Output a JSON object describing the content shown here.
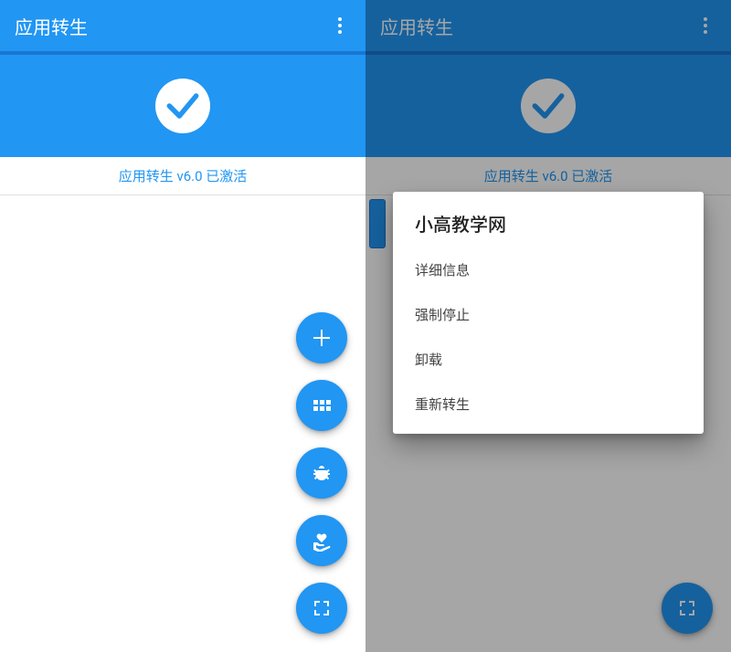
{
  "left": {
    "title": "应用转生",
    "status": "应用转生 v6.0 已激活",
    "fabs": {
      "add": "add",
      "grid": "grid",
      "bug": "bug",
      "heart": "heart-hand",
      "expand": "expand"
    }
  },
  "right": {
    "title": "应用转生",
    "status": "应用转生 v6.0 已激活",
    "dialog": {
      "title": "小高教学网",
      "items": {
        "detail": "详细信息",
        "forceStop": "强制停止",
        "uninstall": "卸载",
        "reclone": "重新转生"
      }
    },
    "fab": "expand"
  },
  "colors": {
    "primary": "#2196F3",
    "primaryDark": "#1976D2"
  }
}
